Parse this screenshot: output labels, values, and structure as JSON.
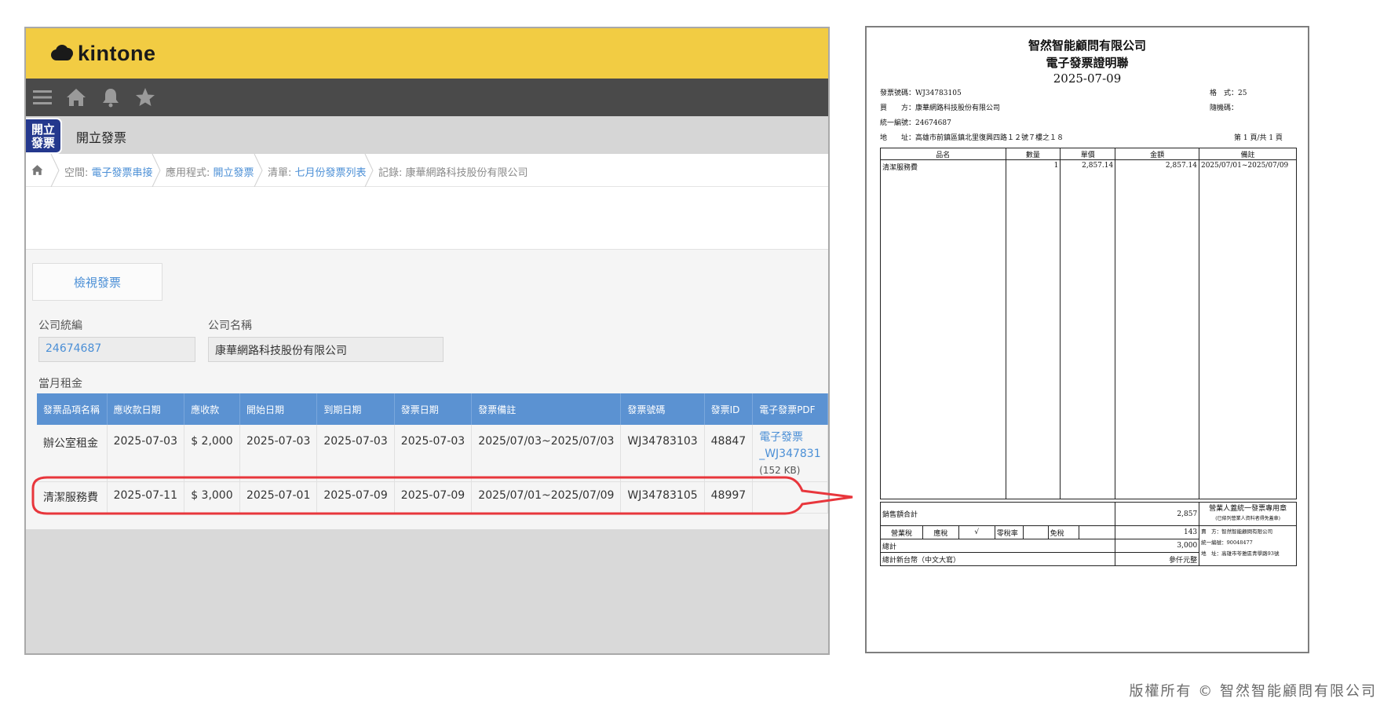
{
  "kintone": {
    "logo_text": "kintone",
    "app_icon_text": "開立\n發票",
    "app_name": "開立發票",
    "breadcrumb": [
      {
        "prefix": "空間: ",
        "link": "電子發票串接"
      },
      {
        "prefix": "應用程式: ",
        "link": "開立發票"
      },
      {
        "prefix": "清單: ",
        "link": "七月份發票列表"
      },
      {
        "prefix": "記錄: 康華網路科技股份有限公司",
        "link": ""
      }
    ],
    "view_invoice_button": "檢視發票",
    "company_id_label": "公司統編",
    "company_id_value": "24674687",
    "company_name_label": "公司名稱",
    "company_name_value": "康華網路科技股份有限公司",
    "table_title": "當月租金",
    "table": {
      "headers": [
        "發票品項名稱",
        "應收款日期",
        "應收款",
        "開始日期",
        "到期日期",
        "發票日期",
        "發票備註",
        "發票號碼",
        "發票ID",
        "電子發票PDF"
      ],
      "rows": [
        [
          "辦公室租金",
          "2025-07-03",
          "$ 2,000",
          "2025-07-03",
          "2025-07-03",
          "2025-07-03",
          "2025/07/03~2025/07/03",
          "WJ34783103",
          "48847",
          "電子發票",
          "_WJ347831",
          "(152 KB)"
        ],
        [
          "清潔服務費",
          "2025-07-11",
          "$ 3,000",
          "2025-07-01",
          "2025-07-09",
          "2025-07-09",
          "2025/07/01~2025/07/09",
          "WJ34783105",
          "48997",
          ""
        ]
      ]
    }
  },
  "invoice": {
    "company": "智然智能顧問有限公司",
    "title": "電子發票證明聯",
    "date": "2025-07-09",
    "number_label": "發票號碼：WJ34783105",
    "format_label": "格　式：25",
    "buyer_label": "買　　方：康華網路科技股份有限公司",
    "random_label": "隨機碼：",
    "taxid_label": "統一編號：24674687",
    "address_label": "地　　址：高雄市前鎮區鎮北里復興四路１２號７樓之１８",
    "page_label": "第 1 頁/共 1 頁",
    "columns": [
      "品名",
      "數量",
      "單價",
      "金額",
      "備註"
    ],
    "item": {
      "name": "清潔服務費",
      "qty": "1",
      "price": "2,857.14",
      "amount": "2,857.14",
      "note": "2025/07/01~2025/07/09"
    },
    "sales_total_label": "銷售額合計",
    "sales_total": "2,857",
    "stamp_title": "營業人蓋統一發票專用章",
    "stamp_sub": "(已條列營業人資料者得免蓋章)",
    "tax_label": "營業稅",
    "taxable_label": "應稅",
    "check": "√",
    "zero_label": "零稅率",
    "exempt_label": "免稅",
    "tax_amount": "143",
    "seller_name": "賣　方：智然智能顧問有限公司",
    "seller_taxid": "統一編號：90048477",
    "seller_address": "地　址：高雄市苓雅區青學路93號",
    "total_label": "總計",
    "total": "3,000",
    "total_words_label": "總計新台幣（中文大寫）",
    "total_words": "參仟元整"
  },
  "copyright": "版權所有 © 智然智能顧問有限公司",
  "colors": {
    "header_yellow": "#f2cc43",
    "nav_dark": "#4a4a4a",
    "table_blue": "#5b92d2",
    "link_blue": "#4b8fd6",
    "highlight_red": "#e8363c"
  }
}
